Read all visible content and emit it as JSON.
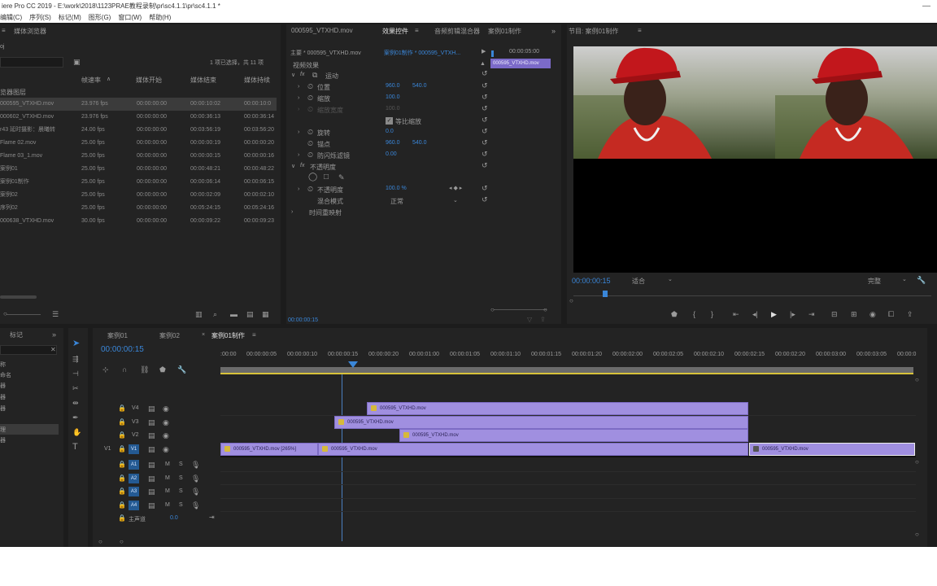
{
  "app_title": "iere Pro CC 2019 - E:\\work\\2018\\1123PRAE教程录制\\pr\\sc4.1.1\\pr\\sc4.1.1 *",
  "menu": [
    "编辑(C)",
    "序列(S)",
    "标记(M)",
    "图形(G)",
    "窗口(W)",
    "帮助(H)"
  ],
  "project": {
    "tab": "媒体浏览器",
    "path": "oj",
    "selection_info": "1 项已选择，共 11 项",
    "columns": [
      "帧速率",
      "媒体开始",
      "媒体结束",
      "媒体持续"
    ],
    "group_label": "览器图层",
    "items": [
      {
        "name": "000595_VTXHD.mov",
        "fps": "23.976 fps",
        "start": "00:00:00:00",
        "end": "00:00:10:02",
        "dur": "00:00:10:0"
      },
      {
        "name": "000602_VTXHD.mov",
        "fps": "23.976 fps",
        "start": "00:00:00:00",
        "end": "00:00:36:13",
        "dur": "00:00:36:14"
      },
      {
        "name": "r43 延时摄影：晨曦转",
        "fps": "24.00 fps",
        "start": "00:00:00:00",
        "end": "00:03:56:19",
        "dur": "00:03:56:20"
      },
      {
        "name": "Flame 02.mov",
        "fps": "25.00 fps",
        "start": "00:00:00:00",
        "end": "00:00:00:19",
        "dur": "00:00:00:20"
      },
      {
        "name": "Flame 03_1.mov",
        "fps": "25.00 fps",
        "start": "00:00:00:00",
        "end": "00:00:00:15",
        "dur": "00:00:00:16"
      },
      {
        "name": "案例01",
        "fps": "25.00 fps",
        "start": "00:00:00:00",
        "end": "00:00:48:21",
        "dur": "00:00:48:22"
      },
      {
        "name": "案例01制作",
        "fps": "25.00 fps",
        "start": "00:00:00:00",
        "end": "00:00:06:14",
        "dur": "00:00:06:15"
      },
      {
        "name": "案例02",
        "fps": "25.00 fps",
        "start": "00:00:00:00",
        "end": "00:00:02:09",
        "dur": "00:00:02:10"
      },
      {
        "name": "序列02",
        "fps": "25.00 fps",
        "start": "00:00:00:00",
        "end": "00:05:24:15",
        "dur": "00:05:24:16"
      },
      {
        "name": "000638_VTXHD.mov",
        "fps": "30.00 fps",
        "start": "00:00:00:00",
        "end": "00:00:09:22",
        "dur": "00:00:09:23"
      }
    ]
  },
  "effects": {
    "tabs": [
      "000595_VTXHD.mov",
      "效果控件",
      "音频剪辑混合器",
      "案例01制作"
    ],
    "master": "主要 * 000595_VTXHD.mov",
    "sequence": "案例01制作 * 000595_VTXH...",
    "mini_time": "00:00:05:00",
    "mini_clip": "000595_VTXHD.mov",
    "section": "视频效果",
    "motion": "运动",
    "position_label": "位置",
    "position_x": "960.0",
    "position_y": "540.0",
    "scale_label": "缩放",
    "scale_value": "100.0",
    "scale_w_label": "缩放宽度",
    "scale_w_value": "100.0",
    "uniform_label": "等比缩放",
    "rotation_label": "旋转",
    "rotation_value": "0.0",
    "anchor_label": "锚点",
    "anchor_x": "960.0",
    "anchor_y": "540.0",
    "flicker_label": "防闪烁滤镜",
    "flicker_value": "0.00",
    "opacity_section": "不透明度",
    "opacity_label": "不透明度",
    "opacity_value": "100.0 %",
    "blend_label": "混合模式",
    "blend_value": "正常",
    "remap_label": "时间重映射",
    "timecode": "00:00:00:15"
  },
  "program": {
    "title": "节目: 案例01制作",
    "timecode": "00:00:00:15",
    "fit": "适合",
    "quality": "完整"
  },
  "tools_panel": {
    "tab": "标记",
    "items": [
      "称",
      "命名",
      "器",
      "器",
      "器",
      "理",
      "器"
    ]
  },
  "timeline": {
    "tabs": [
      "案例01",
      "案例02",
      "案例01制作"
    ],
    "timecode": "00:00:00:15",
    "ruler": [
      ":00:00",
      "00:00:00:05",
      "00:00:00:10",
      "00:00:00:15",
      "00:00:00:20",
      "00:00:01:00",
      "00:00:01:05",
      "00:00:01:10",
      "00:00:01:15",
      "00:00:01:20",
      "00:00:02:00",
      "00:00:02:05",
      "00:00:02:10",
      "00:00:02:15",
      "00:00:02:20",
      "00:00:03:00",
      "00:00:03:05",
      "00:00:0"
    ],
    "video_tracks": [
      "V4",
      "V3",
      "V2",
      "V1"
    ],
    "source_v": "V1",
    "audio_tracks": [
      "A1",
      "A2",
      "A3",
      "A4"
    ],
    "master_label": "主声道",
    "master_value": "0.0",
    "clips": {
      "v4": "000595_VTXHD.mov",
      "v3": "000595_VTXHD.mov",
      "v2": "000595_VTXHD.mov",
      "v1a": "000595_VTXHD.mov [265%]",
      "v1b": "000595_VTXHD.mov",
      "v1c": "000595_VTXHD.mov"
    }
  },
  "colors": {
    "accent": "#3a86d8",
    "clip": "#a08fe0",
    "panel": "#232323",
    "track_target": "#245a93"
  }
}
